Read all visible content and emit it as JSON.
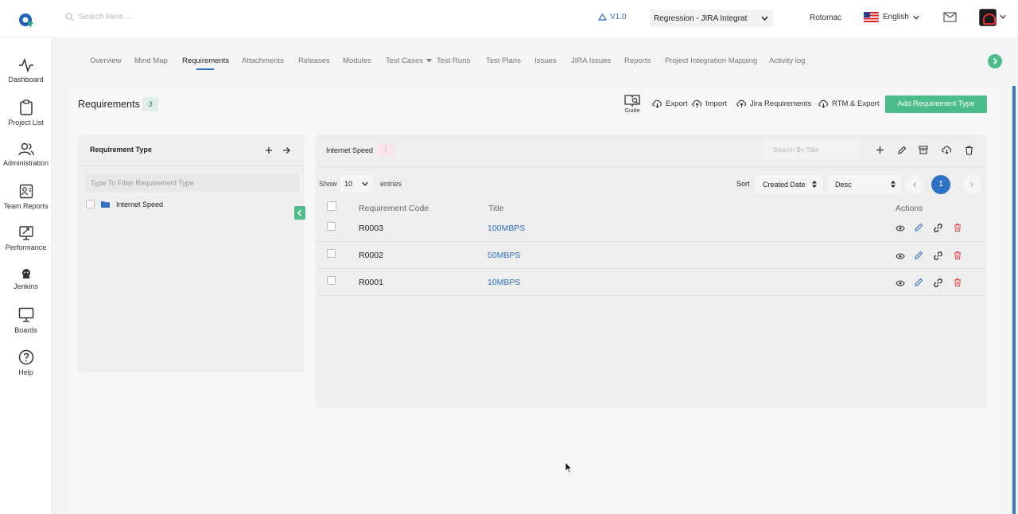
{
  "topbar": {
    "search_placeholder": "Search Here....",
    "version": "V1.0",
    "project_selected": "Regression - JIRA Integration",
    "user_name": "Rotomac",
    "language": "English"
  },
  "sidebar": {
    "items": [
      {
        "label": "Dashboard",
        "icon": "pulse-icon"
      },
      {
        "label": "Project List",
        "icon": "clipboard-icon"
      },
      {
        "label": "Administration",
        "icon": "users-icon"
      },
      {
        "label": "Team Reports",
        "icon": "report-icon"
      },
      {
        "label": "Performance",
        "icon": "performance-icon"
      },
      {
        "label": "Jenkins",
        "icon": "jenkins-icon"
      },
      {
        "label": "Boards",
        "icon": "board-icon"
      },
      {
        "label": "Help",
        "icon": "help-icon"
      }
    ]
  },
  "nav": {
    "tabs": [
      "Overview",
      "Mind Map",
      "Requirements",
      "Attachments",
      "Releases",
      "Modules",
      "Test Cases",
      "Test Runs",
      "Test Plans",
      "Issues",
      "JIRA Issues",
      "Reports",
      "Project Integration Mapping",
      "Activity log"
    ],
    "active": "Requirements"
  },
  "page": {
    "title": "Requirements",
    "count": "3",
    "guide_label": "Guide",
    "export_label": "Export",
    "import_label": "Import",
    "jira_label": "Jira Requirements",
    "rtm_label": "RTM & Export",
    "add_button": "Add Requirement Type"
  },
  "left_panel": {
    "heading": "Requirement Type",
    "filter_placeholder": "Type To Filter Requirement Type",
    "items": [
      "Internet Speed"
    ]
  },
  "right_panel": {
    "heading": "Internet Speed",
    "badge": "⋮",
    "search_placeholder": "Search By Title",
    "show_label": "Show",
    "entries_value": "10",
    "entries_label": "entries",
    "sort_label": "Sort",
    "sort_field": "Created Date",
    "sort_order": "Desc",
    "current_page": "1"
  },
  "table": {
    "headers": {
      "code": "Requirement Code",
      "title": "Title",
      "actions": "Actions"
    },
    "rows": [
      {
        "code": "R0003",
        "title": "100MBPS"
      },
      {
        "code": "R0002",
        "title": "50MBPS"
      },
      {
        "code": "R0001",
        "title": "10MBPS"
      }
    ]
  },
  "colors": {
    "accent_green": "#4cbc8a",
    "accent_blue": "#2f6fc4",
    "delete_red": "#e04848"
  }
}
